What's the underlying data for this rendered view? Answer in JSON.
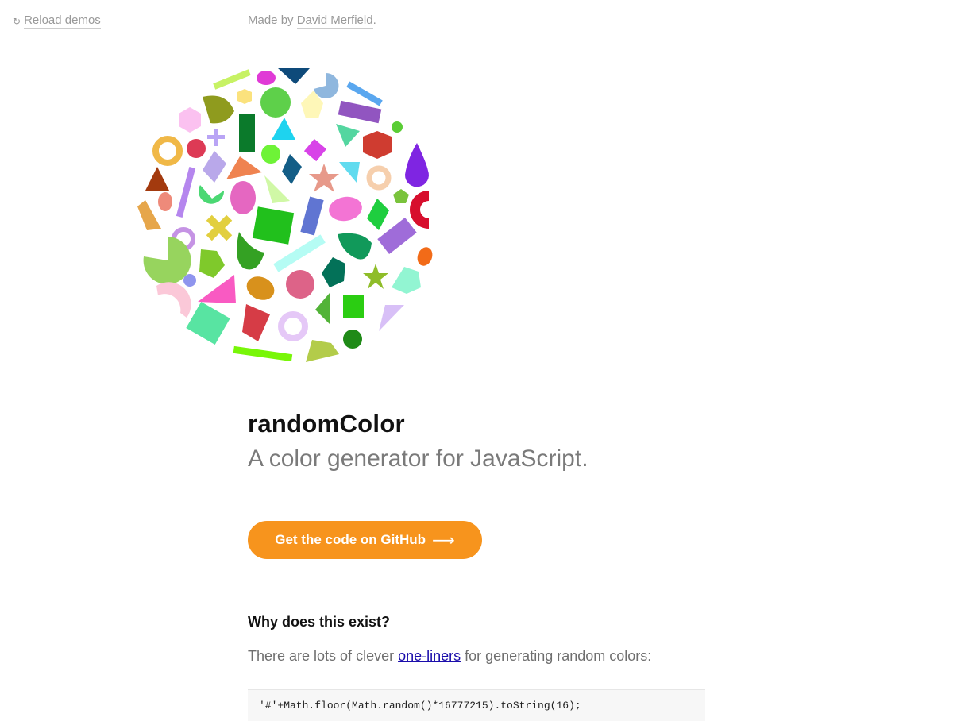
{
  "topbar": {
    "reload_icon": "reload-icon",
    "reload_glyph": "↻",
    "reload_label": "Reload demos",
    "credit_prefix": "Made by ",
    "credit_author": "David Merfield",
    "credit_suffix": "."
  },
  "hero": {
    "title": "randomColor",
    "subtitle": "A color generator for JavaScript."
  },
  "cta": {
    "label": "Get the code on GitHub",
    "arrow": "⟶",
    "color": "#f7941d"
  },
  "why": {
    "heading": "Why does this exist?",
    "text_before": "There are lots of clever ",
    "link": "one-liners",
    "text_after": " for generating random colors:"
  },
  "code": {
    "snippet": "'#'+Math.floor(Math.random()*16777215).toString(16);"
  }
}
